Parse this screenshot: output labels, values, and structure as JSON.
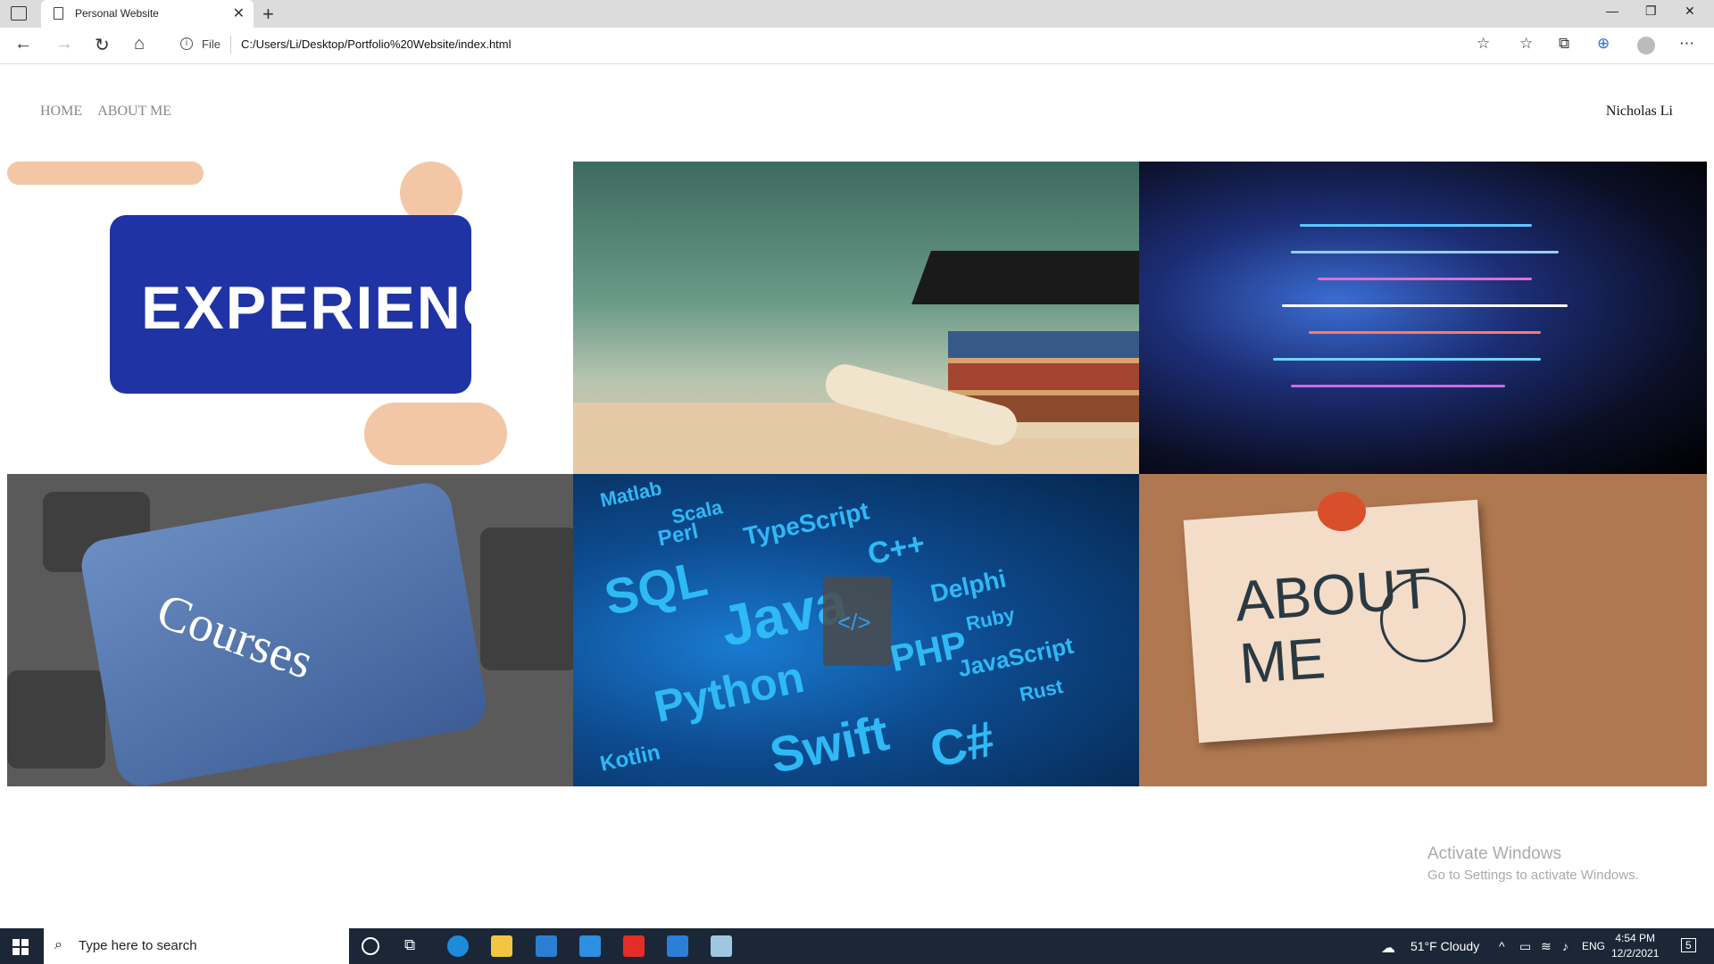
{
  "browser": {
    "tab_title": "Personal Website",
    "address_prefix": "File",
    "url": "C:/Users/Li/Desktop/Portfolio%20Website/index.html"
  },
  "page": {
    "nav": [
      "HOME",
      "ABOUT ME"
    ],
    "owner": "Nicholas Li",
    "tiles": [
      {
        "name": "experience",
        "text": "EXPERIENCE"
      },
      {
        "name": "education",
        "text": ""
      },
      {
        "name": "code",
        "text": ""
      },
      {
        "name": "courses",
        "text": "Courses"
      },
      {
        "name": "languages",
        "text": ""
      },
      {
        "name": "about",
        "text": "ABOUT ME"
      }
    ],
    "language_words": [
      "Matlab",
      "Scala",
      "Perl",
      "TypeScript",
      "SQL",
      "Java",
      "Python",
      "PHP",
      "Swift",
      "C#",
      "JavaScript",
      "Delphi",
      "Ruby",
      "Rust",
      "Kotlin",
      "C++"
    ]
  },
  "watermark": {
    "title": "Activate Windows",
    "subtitle": "Go to Settings to activate Windows."
  },
  "taskbar": {
    "search_placeholder": "Type here to search",
    "weather": "51°F  Cloudy",
    "language": "ENG",
    "time": "4:54 PM",
    "date": "12/2/2021",
    "notifications": "5"
  },
  "colors": {
    "taskbar": "#1b2736",
    "accent": "#2fb9f5"
  }
}
